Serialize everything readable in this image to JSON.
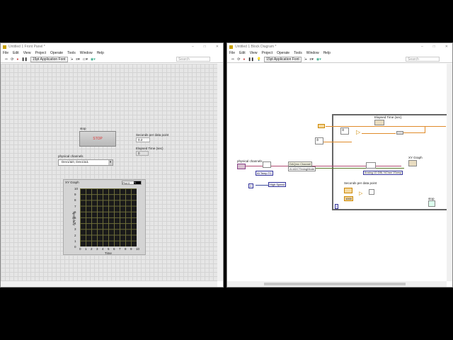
{
  "menu": [
    "File",
    "Edit",
    "View",
    "Project",
    "Operate",
    "Tools",
    "Window",
    "Help"
  ],
  "font_label": "15pt Application Font",
  "search_placeholder": "Search",
  "front_panel": {
    "title": "Untitled 1 Front Panel *",
    "stop_label": "stop",
    "stop_button": "STOP",
    "seconds_label": "Seconds per data point",
    "seconds_value": "0.2",
    "elapsed_label": "Elapsed Time (sec)",
    "elapsed_value": "0",
    "channels_label": "physical channels",
    "channels_value": "Dev1/ai0, Dev1/ai1",
    "graph": {
      "title": "XY Graph",
      "legend": "Plot 0",
      "xlabel": "Time",
      "ylabel": "Amplitude",
      "xticks": [
        "0",
        "1",
        "2",
        "3",
        "4",
        "5",
        "6",
        "7",
        "8",
        "9",
        "10"
      ],
      "yticks": [
        "10",
        "9",
        "8",
        "7",
        "6",
        "5",
        "4",
        "3",
        "2",
        "1",
        "0"
      ]
    }
  },
  "block_diagram": {
    "title": "Untitled 1 Block Diagram *",
    "channels_label": "physical channels",
    "temp_tc": "AI Temp TC",
    "channel_prop": "DAQmx Channel",
    "adc_prop": "AI.ADCTimingMode",
    "high_speed": "High Speed",
    "unit": "C",
    "elapsed_label": "Elapsed Time (sec)",
    "read_mode": "Analog 1D DBL NChan 1Samp",
    "seconds_label": "Seconds per data point",
    "seconds_const": "1000",
    "xy_graph_label": "XY Graph",
    "stop_label": "stop",
    "loop_index": "i"
  }
}
